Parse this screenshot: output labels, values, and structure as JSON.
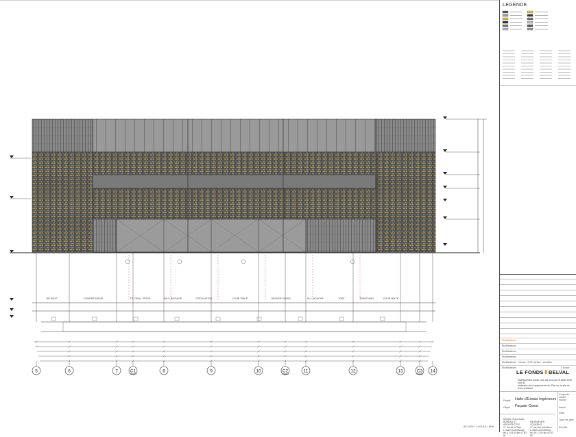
{
  "legend": {
    "title": "LEGENDE"
  },
  "rooms": [
    "BP WKST",
    "COMPRESSEUR",
    "TR. GRAL / PROD.",
    "EAU / BOIDAGE",
    "CIRCULATION",
    "COUR TABLE",
    "GROUPE DIESEL",
    "ELL. BOUCHE",
    "TGBT",
    "TRANS ANO.",
    "COUR MIXTE"
  ],
  "axes": [
    "5",
    "6",
    "7",
    "C1",
    "8",
    "9",
    "10",
    "C2",
    "11",
    "12",
    "13",
    "C3",
    "14"
  ],
  "titleblock": {
    "modifications_header": "Modifications",
    "modifications": [
      "Modifications",
      "Modifications",
      "Modifications",
      "Modifications : niveau +0,00, lanterr., corniche",
      "Modifications"
    ],
    "index_label": "Indice",
    "logo_left": "LE FONDS",
    "logo_right": "BELVAL",
    "logo_sub_lines": [
      "Établissement public créé par la loi du 25 juillet 2002 pour la",
      "réalisation des équipements de l'État sur le site de Esch-s/-Belval"
    ],
    "projet_label": "Projet",
    "projet_value": "Halle d'Essais Ingénieurs",
    "objet_label": "Objet",
    "objet_value": "Façade Ouest",
    "right_labels": [
      "Corps de métier",
      "Fichier",
      "Indice",
      "Date",
      "Type de plan",
      "Echelle"
    ],
    "maitre_label": "Maître d'Ouvrage",
    "footer_left": [
      "BUREAU ET ARCHITECTES",
      "17 rue de la Gare",
      "L-1620 Luxembourg",
      "tél. 47 43 82   fax 47 50 61"
    ],
    "footer_right": [
      "INGÉNIEURS CONSEILS",
      "17 rue des Industries",
      "L-1620 Luxembourg",
      "tél. 40 17 93   fax 40 52 53"
    ]
  },
  "scale_note": "A0 1/200 + 1/100 A3 = 80%",
  "colors": {
    "line": "#333333",
    "masonry": "#4a4845",
    "masonry_accent": "#d9c24a",
    "cladding": "#8a8a8a",
    "orange": "#e07a12",
    "red_dash": "#d04040"
  }
}
